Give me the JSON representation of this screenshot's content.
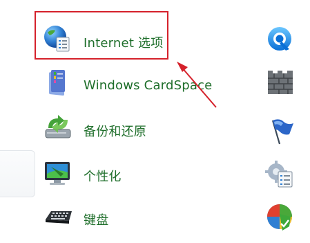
{
  "items": [
    {
      "label": "Internet 选项",
      "icon": "internet-options-globe-icon",
      "right_icon": "quicktime-icon"
    },
    {
      "label": "Windows CardSpace",
      "icon": "cardspace-icon",
      "right_icon": "firewall-brick-icon"
    },
    {
      "label": "备份和还原",
      "icon": "backup-restore-icon",
      "right_icon": "action-center-flag-icon"
    },
    {
      "label": "个性化",
      "icon": "personalization-monitor-icon",
      "right_icon": "programs-features-icon"
    },
    {
      "label": "键盘",
      "icon": "keyboard-icon",
      "right_icon": "windows-defender-icon"
    }
  ],
  "colors": {
    "link_text": "#1e6e2a",
    "highlight": "#d5212b"
  }
}
